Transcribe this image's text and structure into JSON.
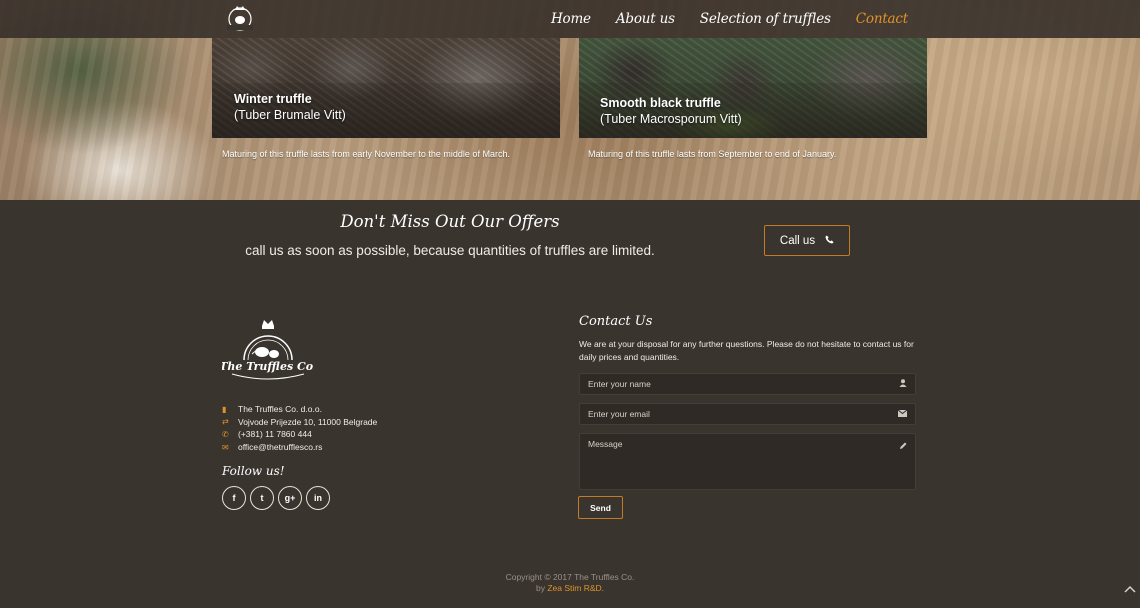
{
  "nav": {
    "items": [
      "Home",
      "About us",
      "Selection of truffles",
      "Contact"
    ],
    "active": "Contact",
    "logo_text": "The Truffles Co."
  },
  "cards": [
    {
      "title": "Winter truffle",
      "latin": "(Tuber Brumale Vitt)",
      "maturing": "Maturing of this truffle lasts from early November to the middle of March."
    },
    {
      "title": "Smooth black truffle",
      "latin": "(Tuber Macrosporum Vitt)",
      "maturing": "Maturing of this truffle lasts from September to end of January."
    }
  ],
  "offer": {
    "title": "Don't Miss Out Our Offers",
    "subtitle": "call us as soon as possible, because quantities of truffles are limited.",
    "button": "Call us"
  },
  "footer": {
    "logo_text": "The Truffles Co.",
    "company": "The Truffles Co. d.o.o.",
    "address": "Vojvode Prijezde 10, 11000 Belgrade",
    "phone": "(+381) 11 7860 444",
    "email": "office@thetrufflesco.rs",
    "follow": "Follow us!",
    "socials": [
      "f",
      "t",
      "g+",
      "in"
    ]
  },
  "contact": {
    "title": "Contact Us",
    "text": "We are at your disposal for any further questions. Please do not hesitate to contact us for daily prices and quantities.",
    "name_placeholder": "Enter your name",
    "email_placeholder": "Enter your email",
    "message_placeholder": "Message",
    "send": "Send"
  },
  "copyright": {
    "line1": "Copyright © 2017 The Truffles Co.",
    "by": "by",
    "author": "Zea Stim R&D."
  },
  "colors": {
    "accent": "#e0922a",
    "background": "#3a342f"
  }
}
